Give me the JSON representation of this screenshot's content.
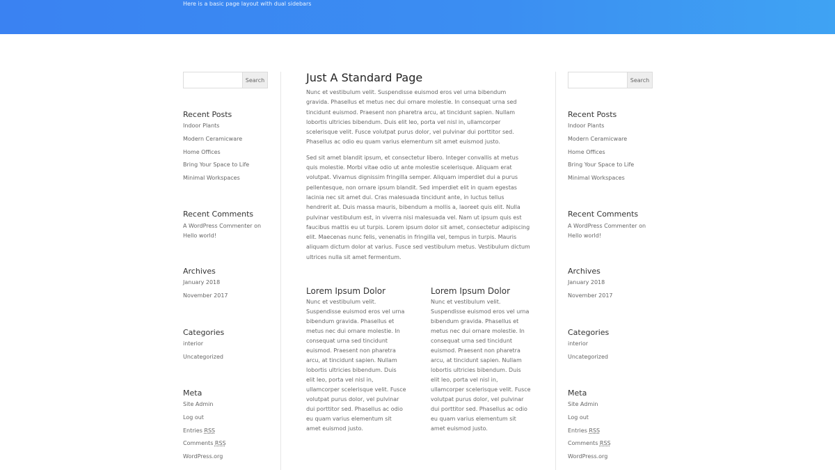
{
  "header": {
    "subtitle": "Here is a basic page layout with dual sidebars",
    "colors": {
      "start": "#3a82f2",
      "end": "#3fa3f3"
    }
  },
  "sidebar": {
    "search_placeholder": "",
    "search_button": "Search",
    "recent_posts": {
      "title": "Recent Posts",
      "items": [
        "Indoor Plants",
        "Modern Ceramicware",
        "Home Offices",
        "Bring Your Space to Life",
        "Minimal Workspaces"
      ]
    },
    "recent_comments": {
      "title": "Recent Comments",
      "author": "A WordPress Commenter",
      "on": "on",
      "post": "Hello world!"
    },
    "archives": {
      "title": "Archives",
      "items": [
        "January 2018",
        "November 2017"
      ]
    },
    "categories": {
      "title": "Categories",
      "items": [
        "interior",
        "Uncategorized"
      ]
    },
    "meta": {
      "title": "Meta",
      "items": [
        "Site Admin",
        "Log out",
        "Entries",
        "Comments",
        "WordPress.org"
      ],
      "rss": "RSS"
    }
  },
  "main": {
    "title": "Just A Standard Page",
    "paragraphs": [
      "Nunc et vestibulum velit. Suspendisse euismod eros vel urna bibendum gravida. Phasellus et metus nec dui ornare molestie. In consequat urna sed tincidunt euismod. Praesent non pharetra arcu, at tincidunt sapien. Nullam lobortis ultricies bibendum. Duis elit leo, porta vel nisl in, ullamcorper scelerisque velit. Fusce volutpat purus dolor, vel pulvinar dui porttitor sed. Phasellus ac odio eu quam varius elementum sit amet euismod justo.",
      "Sed sit amet blandit ipsum, et consectetur libero. Integer convallis at metus quis molestie. Morbi vitae odio ut ante molestie scelerisque. Aliquam erat volutpat. Vivamus dignissim fringilla semper. Aliquam imperdiet dui a purus pellentesque, non ornare ipsum blandit. Sed imperdiet elit in quam egestas lacinia nec sit amet dui. Cras malesuada tincidunt ante, in luctus tellus hendrerit at. Duis massa mauris, bibendum a mollis a, laoreet quis elit. Nulla pulvinar vestibulum est, in viverra nisi malesuada vel. Nam ut ipsum quis est faucibus mattis eu ut turpis. Lorem ipsum dolor sit amet, consectetur adipiscing elit. Maecenas nunc felis, venenatis in fringilla vel, tempus in turpis. Mauris aliquam dictum dolor at varius. Fusce sed vestibulum metus. Vestibulum dictum ultrices nulla sit amet fermentum."
    ],
    "columns": [
      {
        "title": "Lorem Ipsum Dolor",
        "text": "Nunc et vestibulum velit. Suspendisse euismod eros vel urna bibendum gravida. Phasellus et metus nec dui ornare molestie. In consequat urna sed tincidunt euismod. Praesent non pharetra arcu, at tincidunt sapien. Nullam lobortis ultricies bibendum. Duis elit leo, porta vel nisl in, ullamcorper scelerisque velit. Fusce volutpat purus dolor, vel pulvinar dui porttitor sed. Phasellus ac odio eu quam varius elementum sit amet euismod justo."
      },
      {
        "title": "Lorem Ipsum Dolor",
        "text": "Nunc et vestibulum velit. Suspendisse euismod eros vel urna bibendum gravida. Phasellus et metus nec dui ornare molestie. In consequat urna sed tincidunt euismod. Praesent non pharetra arcu, at tincidunt sapien. Nullam lobortis ultricies bibendum. Duis elit leo, porta vel nisl in, ullamcorper scelerisque velit. Fusce volutpat purus dolor, vel pulvinar dui porttitor sed. Phasellus ac odio eu quam varius elementum sit amet euismod justo."
      }
    ]
  }
}
